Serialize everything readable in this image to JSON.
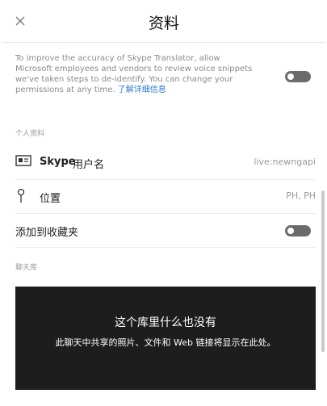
{
  "header": {
    "title": "资料"
  },
  "privacy": {
    "text": "To improve the accuracy of Skype Translator, allow Microsoft employees and vendors to review voice snippets we've taken steps to de-identify. You can change your permissions at any time. ",
    "link": "了解详细信息"
  },
  "profile": {
    "section_title": "个人资料",
    "skype_name": {
      "brand": "Skype",
      "label": "用户名",
      "value": "live:newngapi"
    },
    "location": {
      "label": "位置",
      "value": "PH, PH"
    },
    "favorites": {
      "label": "添加到收藏夹"
    }
  },
  "library": {
    "section_title": "聊天库",
    "empty_title": "这个库里什么也没有",
    "empty_text": "此聊天中共享的照片、文件和 Web 链接将显示在此处。"
  },
  "colors": {
    "toggle_off": "#6b6b6b",
    "link": "#2a79d6",
    "panel_bg": "#1d1d1d"
  }
}
